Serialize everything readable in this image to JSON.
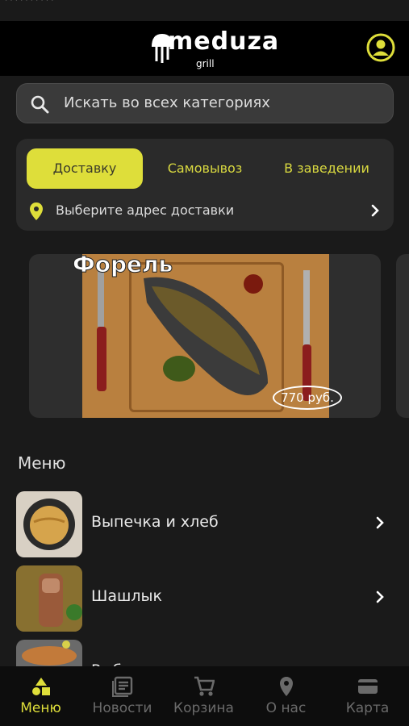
{
  "status": {
    "text": "· · · · · · · · · ·"
  },
  "header": {
    "logo_text": "meduza",
    "logo_sub": "grill",
    "profile_icon": "profile-icon"
  },
  "search": {
    "placeholder": "Искать во всех категориях",
    "icon": "search-icon"
  },
  "delivery": {
    "modes": [
      "Доставку",
      "Самовывоз",
      "В заведении"
    ],
    "active_mode": "Доставку",
    "address_prompt": "Выберите адрес доставки"
  },
  "promo": {
    "title": "Форель",
    "price": "770 руб."
  },
  "menu": {
    "title": "Меню",
    "items": [
      {
        "label": "Выпечка и хлеб"
      },
      {
        "label": "Шашлык"
      },
      {
        "label": "Рыба на гриле"
      }
    ]
  },
  "tabbar": {
    "tabs": [
      {
        "label": "Меню",
        "icon": "shapes-icon",
        "active": true
      },
      {
        "label": "Новости",
        "icon": "news-icon",
        "active": false
      },
      {
        "label": "Корзина",
        "icon": "cart-icon",
        "active": false
      },
      {
        "label": "О нас",
        "icon": "location-pin-icon",
        "active": false
      },
      {
        "label": "Карта",
        "icon": "card-icon",
        "active": false
      }
    ]
  },
  "colors": {
    "accent": "#dede3a",
    "background": "#1a1a1a",
    "card": "#2a2a2a",
    "header": "#000000"
  }
}
